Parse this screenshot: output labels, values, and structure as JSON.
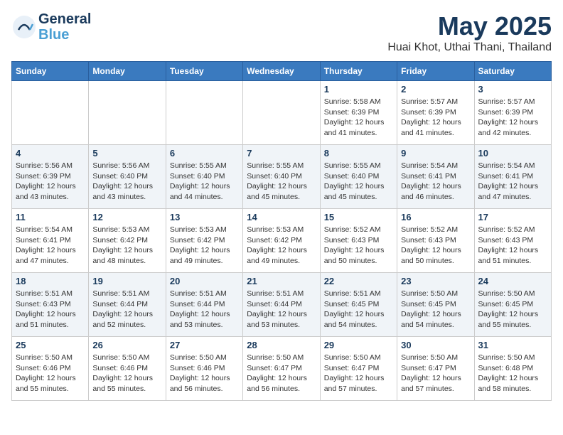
{
  "header": {
    "logo_general": "General",
    "logo_blue": "Blue",
    "month_title": "May 2025",
    "location": "Huai Khot, Uthai Thani, Thailand"
  },
  "days_of_week": [
    "Sunday",
    "Monday",
    "Tuesday",
    "Wednesday",
    "Thursday",
    "Friday",
    "Saturday"
  ],
  "weeks": [
    [
      {
        "day": "",
        "info": ""
      },
      {
        "day": "",
        "info": ""
      },
      {
        "day": "",
        "info": ""
      },
      {
        "day": "",
        "info": ""
      },
      {
        "day": "1",
        "info": "Sunrise: 5:58 AM\nSunset: 6:39 PM\nDaylight: 12 hours\nand 41 minutes."
      },
      {
        "day": "2",
        "info": "Sunrise: 5:57 AM\nSunset: 6:39 PM\nDaylight: 12 hours\nand 41 minutes."
      },
      {
        "day": "3",
        "info": "Sunrise: 5:57 AM\nSunset: 6:39 PM\nDaylight: 12 hours\nand 42 minutes."
      }
    ],
    [
      {
        "day": "4",
        "info": "Sunrise: 5:56 AM\nSunset: 6:39 PM\nDaylight: 12 hours\nand 43 minutes."
      },
      {
        "day": "5",
        "info": "Sunrise: 5:56 AM\nSunset: 6:40 PM\nDaylight: 12 hours\nand 43 minutes."
      },
      {
        "day": "6",
        "info": "Sunrise: 5:55 AM\nSunset: 6:40 PM\nDaylight: 12 hours\nand 44 minutes."
      },
      {
        "day": "7",
        "info": "Sunrise: 5:55 AM\nSunset: 6:40 PM\nDaylight: 12 hours\nand 45 minutes."
      },
      {
        "day": "8",
        "info": "Sunrise: 5:55 AM\nSunset: 6:40 PM\nDaylight: 12 hours\nand 45 minutes."
      },
      {
        "day": "9",
        "info": "Sunrise: 5:54 AM\nSunset: 6:41 PM\nDaylight: 12 hours\nand 46 minutes."
      },
      {
        "day": "10",
        "info": "Sunrise: 5:54 AM\nSunset: 6:41 PM\nDaylight: 12 hours\nand 47 minutes."
      }
    ],
    [
      {
        "day": "11",
        "info": "Sunrise: 5:54 AM\nSunset: 6:41 PM\nDaylight: 12 hours\nand 47 minutes."
      },
      {
        "day": "12",
        "info": "Sunrise: 5:53 AM\nSunset: 6:42 PM\nDaylight: 12 hours\nand 48 minutes."
      },
      {
        "day": "13",
        "info": "Sunrise: 5:53 AM\nSunset: 6:42 PM\nDaylight: 12 hours\nand 49 minutes."
      },
      {
        "day": "14",
        "info": "Sunrise: 5:53 AM\nSunset: 6:42 PM\nDaylight: 12 hours\nand 49 minutes."
      },
      {
        "day": "15",
        "info": "Sunrise: 5:52 AM\nSunset: 6:43 PM\nDaylight: 12 hours\nand 50 minutes."
      },
      {
        "day": "16",
        "info": "Sunrise: 5:52 AM\nSunset: 6:43 PM\nDaylight: 12 hours\nand 50 minutes."
      },
      {
        "day": "17",
        "info": "Sunrise: 5:52 AM\nSunset: 6:43 PM\nDaylight: 12 hours\nand 51 minutes."
      }
    ],
    [
      {
        "day": "18",
        "info": "Sunrise: 5:51 AM\nSunset: 6:43 PM\nDaylight: 12 hours\nand 51 minutes."
      },
      {
        "day": "19",
        "info": "Sunrise: 5:51 AM\nSunset: 6:44 PM\nDaylight: 12 hours\nand 52 minutes."
      },
      {
        "day": "20",
        "info": "Sunrise: 5:51 AM\nSunset: 6:44 PM\nDaylight: 12 hours\nand 53 minutes."
      },
      {
        "day": "21",
        "info": "Sunrise: 5:51 AM\nSunset: 6:44 PM\nDaylight: 12 hours\nand 53 minutes."
      },
      {
        "day": "22",
        "info": "Sunrise: 5:51 AM\nSunset: 6:45 PM\nDaylight: 12 hours\nand 54 minutes."
      },
      {
        "day": "23",
        "info": "Sunrise: 5:50 AM\nSunset: 6:45 PM\nDaylight: 12 hours\nand 54 minutes."
      },
      {
        "day": "24",
        "info": "Sunrise: 5:50 AM\nSunset: 6:45 PM\nDaylight: 12 hours\nand 55 minutes."
      }
    ],
    [
      {
        "day": "25",
        "info": "Sunrise: 5:50 AM\nSunset: 6:46 PM\nDaylight: 12 hours\nand 55 minutes."
      },
      {
        "day": "26",
        "info": "Sunrise: 5:50 AM\nSunset: 6:46 PM\nDaylight: 12 hours\nand 55 minutes."
      },
      {
        "day": "27",
        "info": "Sunrise: 5:50 AM\nSunset: 6:46 PM\nDaylight: 12 hours\nand 56 minutes."
      },
      {
        "day": "28",
        "info": "Sunrise: 5:50 AM\nSunset: 6:47 PM\nDaylight: 12 hours\nand 56 minutes."
      },
      {
        "day": "29",
        "info": "Sunrise: 5:50 AM\nSunset: 6:47 PM\nDaylight: 12 hours\nand 57 minutes."
      },
      {
        "day": "30",
        "info": "Sunrise: 5:50 AM\nSunset: 6:47 PM\nDaylight: 12 hours\nand 57 minutes."
      },
      {
        "day": "31",
        "info": "Sunrise: 5:50 AM\nSunset: 6:48 PM\nDaylight: 12 hours\nand 58 minutes."
      }
    ]
  ]
}
